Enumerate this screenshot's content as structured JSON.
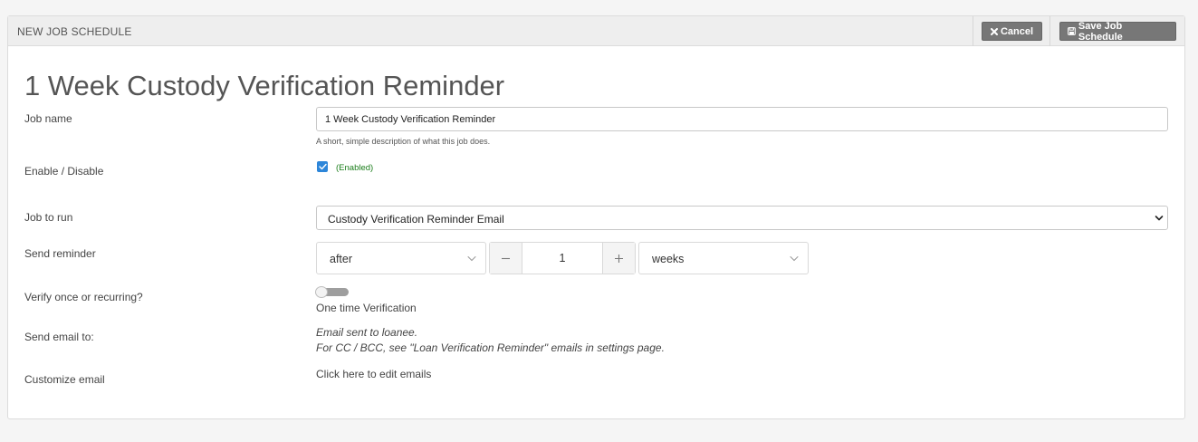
{
  "header": {
    "title": "NEW JOB SCHEDULE",
    "cancel_label": "Cancel",
    "save_label": "Save Job Schedule"
  },
  "form": {
    "title": "1 Week Custody Verification Reminder",
    "job_name": {
      "label": "Job name",
      "value": "1 Week Custody Verification Reminder",
      "help": "A short, simple description of what this job does."
    },
    "enable": {
      "label": "Enable / Disable",
      "checked": true,
      "status": "(Enabled)"
    },
    "job_to_run": {
      "label": "Job to run",
      "selected": "Custody Verification Reminder Email"
    },
    "send_reminder": {
      "label": "Send reminder",
      "timing": "after",
      "quantity": "1",
      "unit": "weeks"
    },
    "verify": {
      "label": "Verify once or recurring?",
      "toggle_on": false,
      "status": "One time Verification"
    },
    "send_email_to": {
      "label": "Send email to:",
      "line1": "Email sent to loanee.",
      "line2": "For CC / BCC, see \"Loan Verification Reminder\" emails in settings page."
    },
    "customize": {
      "label": "Customize email",
      "link": "Click here to edit emails"
    }
  },
  "colors": {
    "page_bg": "#f5f5f5",
    "header_bg": "#eeeeee",
    "button_bg": "#777777",
    "checkbox": "#2d86d9",
    "enabled_text": "#1a7d1a",
    "toggle_off": "#9e9e9e"
  },
  "icons": {
    "cancel": "close-icon",
    "save": "floppy-disk-icon",
    "select": "chevron-down-icon",
    "stepper_minus": "minus-icon",
    "stepper_plus": "plus-icon"
  }
}
